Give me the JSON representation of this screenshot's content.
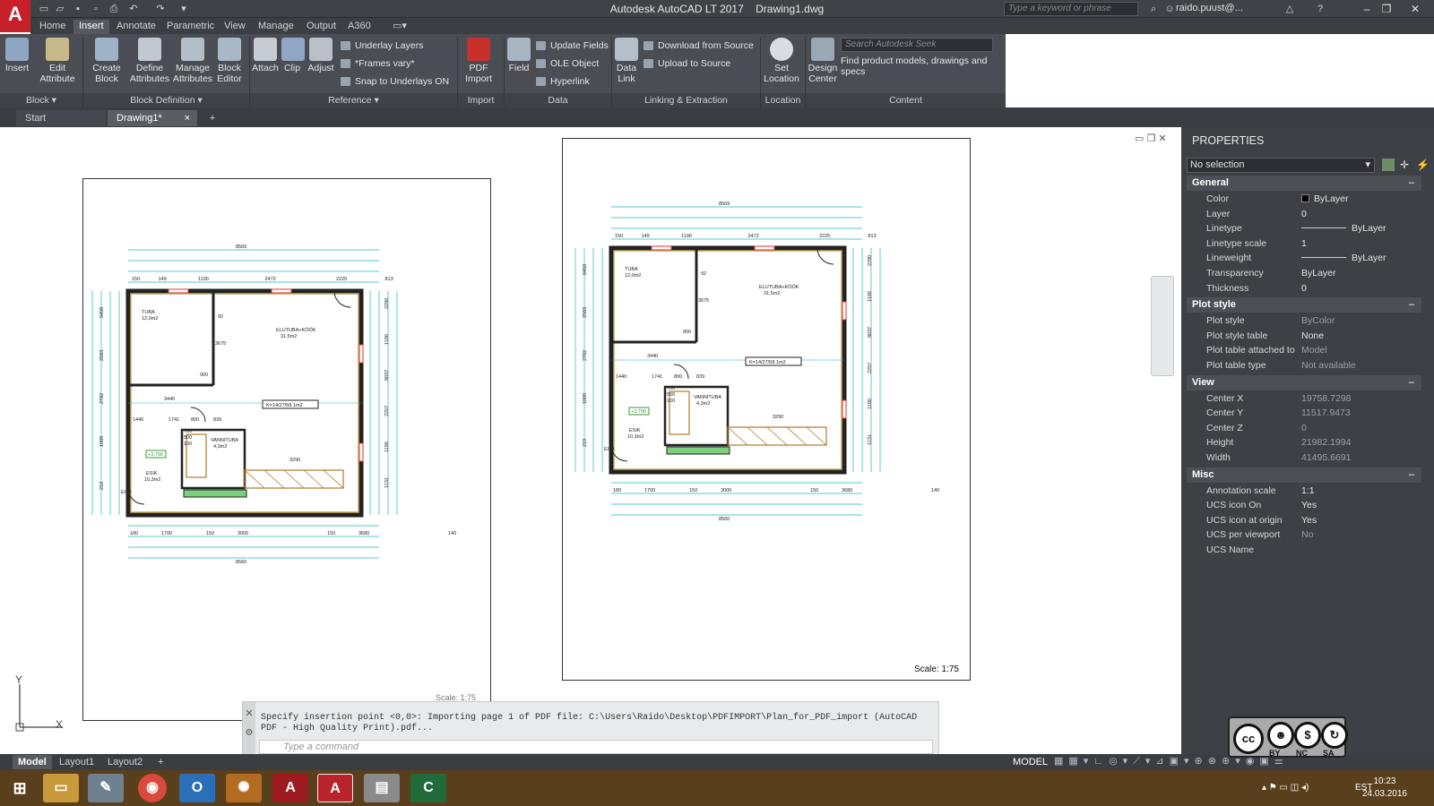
{
  "app": {
    "title": "Autodesk AutoCAD LT 2017",
    "document": "Drawing1.dwg",
    "search_placeholder": "Type a keyword or phrase",
    "user": "raido.puust@..."
  },
  "menu_tabs": [
    "Home",
    "Insert",
    "Annotate",
    "Parametric",
    "View",
    "Manage",
    "Output",
    "A360"
  ],
  "active_tab": "Insert",
  "ribbon": {
    "insert": "Insert",
    "edit_attribute": "Edit\nAttribute",
    "create_block": "Create\nBlock",
    "define_attributes": "Define\nAttributes",
    "manage_attributes": "Manage\nAttributes",
    "block_editor": "Block\nEditor",
    "attach": "Attach",
    "clip": "Clip",
    "adjust": "Adjust",
    "underlay_layers": "Underlay Layers",
    "frames_vary": "*Frames vary*",
    "snap_to_underlays": "Snap to Underlays ON",
    "pdf_import": "PDF\nImport",
    "field": "Field",
    "update_fields": "Update Fields",
    "ole_object": "OLE Object",
    "hyperlink": "Hyperlink",
    "data_link": "Data\nLink",
    "download_from_source": "Download from Source",
    "upload_to_source": "Upload to Source",
    "set_location": "Set\nLocation",
    "design_center": "Design\nCenter",
    "seek_placeholder": "Search Autodesk Seek",
    "seek_caption": "Find product models, drawings and specs",
    "panels": {
      "block": "Block",
      "block_definition": "Block Definition",
      "reference": "Reference",
      "import": "Import",
      "data": "Data",
      "linking": "Linking & Extraction",
      "location": "Location",
      "content": "Content"
    }
  },
  "file_tabs": [
    "Start",
    "Drawing1*"
  ],
  "drawing": {
    "left_scale": "Scale: 1:75",
    "right_scale": "Scale:  1:75",
    "ucs_y": "Y",
    "ucs_x": "X",
    "plan": {
      "top_total": "8569",
      "top_dims": [
        "150",
        "149",
        "1190",
        "2472",
        "2225",
        "813"
      ],
      "bottom_total": "8560",
      "bottom_dims": [
        "180",
        "1700",
        "150",
        "3000",
        "150",
        "3680",
        "140"
      ],
      "room_tuba": "TUBA",
      "room_tuba_area": "12,0m2",
      "room_elutuba": "ELUTUBA+KÖÖK",
      "room_elutuba_area": "31,5m2",
      "room_vannituba": "VANNITUBA",
      "room_vannituba_area": "4,3m2",
      "room_esik": "ESIK",
      "room_esik_area": "10,3m2",
      "total_label": "K=14/27/58.1m2",
      "level_tag": "+3.790",
      "door_tag": "EI30",
      "left_dims": [
        "6458",
        "2583",
        "2782",
        "1009",
        "219"
      ],
      "right_dims": [
        "2290",
        "1190",
        "8037",
        "2257",
        "1190",
        "1131"
      ],
      "inner_dims": [
        "3675",
        "900",
        "1440",
        "1741",
        "800",
        "839",
        "700",
        "500",
        "100",
        "3290",
        "3440",
        "92"
      ]
    }
  },
  "properties": {
    "title": "PROPERTIES",
    "selection": "No selection",
    "sections": [
      {
        "name": "General",
        "rows": [
          {
            "k": "Color",
            "v": "ByLayer",
            "swatch": "#000000"
          },
          {
            "k": "Layer",
            "v": "0"
          },
          {
            "k": "Linetype",
            "v": "ByLayer",
            "line": true
          },
          {
            "k": "Linetype scale",
            "v": "1"
          },
          {
            "k": "Lineweight",
            "v": "ByLayer",
            "line": true
          },
          {
            "k": "Transparency",
            "v": "ByLayer"
          },
          {
            "k": "Thickness",
            "v": "0"
          }
        ]
      },
      {
        "name": "Plot style",
        "rows": [
          {
            "k": "Plot style",
            "v": "ByColor",
            "dim": true
          },
          {
            "k": "Plot style table",
            "v": "None"
          },
          {
            "k": "Plot table attached to",
            "v": "Model",
            "dim": true
          },
          {
            "k": "Plot table type",
            "v": "Not available",
            "dim": true
          }
        ]
      },
      {
        "name": "View",
        "rows": [
          {
            "k": "Center X",
            "v": "19758.7298",
            "dim": true
          },
          {
            "k": "Center Y",
            "v": "11517.9473",
            "dim": true
          },
          {
            "k": "Center Z",
            "v": "0",
            "dim": true
          },
          {
            "k": "Height",
            "v": "21982.1994",
            "dim": true
          },
          {
            "k": "Width",
            "v": "41495.6691",
            "dim": true
          }
        ]
      },
      {
        "name": "Misc",
        "rows": [
          {
            "k": "Annotation scale",
            "v": "1:1"
          },
          {
            "k": "UCS icon On",
            "v": "Yes"
          },
          {
            "k": "UCS icon at origin",
            "v": "Yes"
          },
          {
            "k": "UCS per viewport",
            "v": "No",
            "dim": true
          },
          {
            "k": "UCS Name",
            "v": ""
          }
        ]
      }
    ]
  },
  "command": {
    "history": "Specify insertion point <0,0>: Importing page 1 of PDF file: C:\\Users\\Raido\\Desktop\\PDFIMPORT\\Plan_for_PDF_import (AutoCAD PDF - High Quality Print).pdf...",
    "placeholder": "Type a command"
  },
  "layout_tabs": [
    "Model",
    "Layout1",
    "Layout2"
  ],
  "status": {
    "model": "MODEL"
  },
  "taskbar": {
    "lang": "EST",
    "time": "10:23",
    "date": "24.03.2016"
  },
  "license": {
    "cc": "cc",
    "by": "BY",
    "nc": "NC",
    "sa": "SA"
  }
}
